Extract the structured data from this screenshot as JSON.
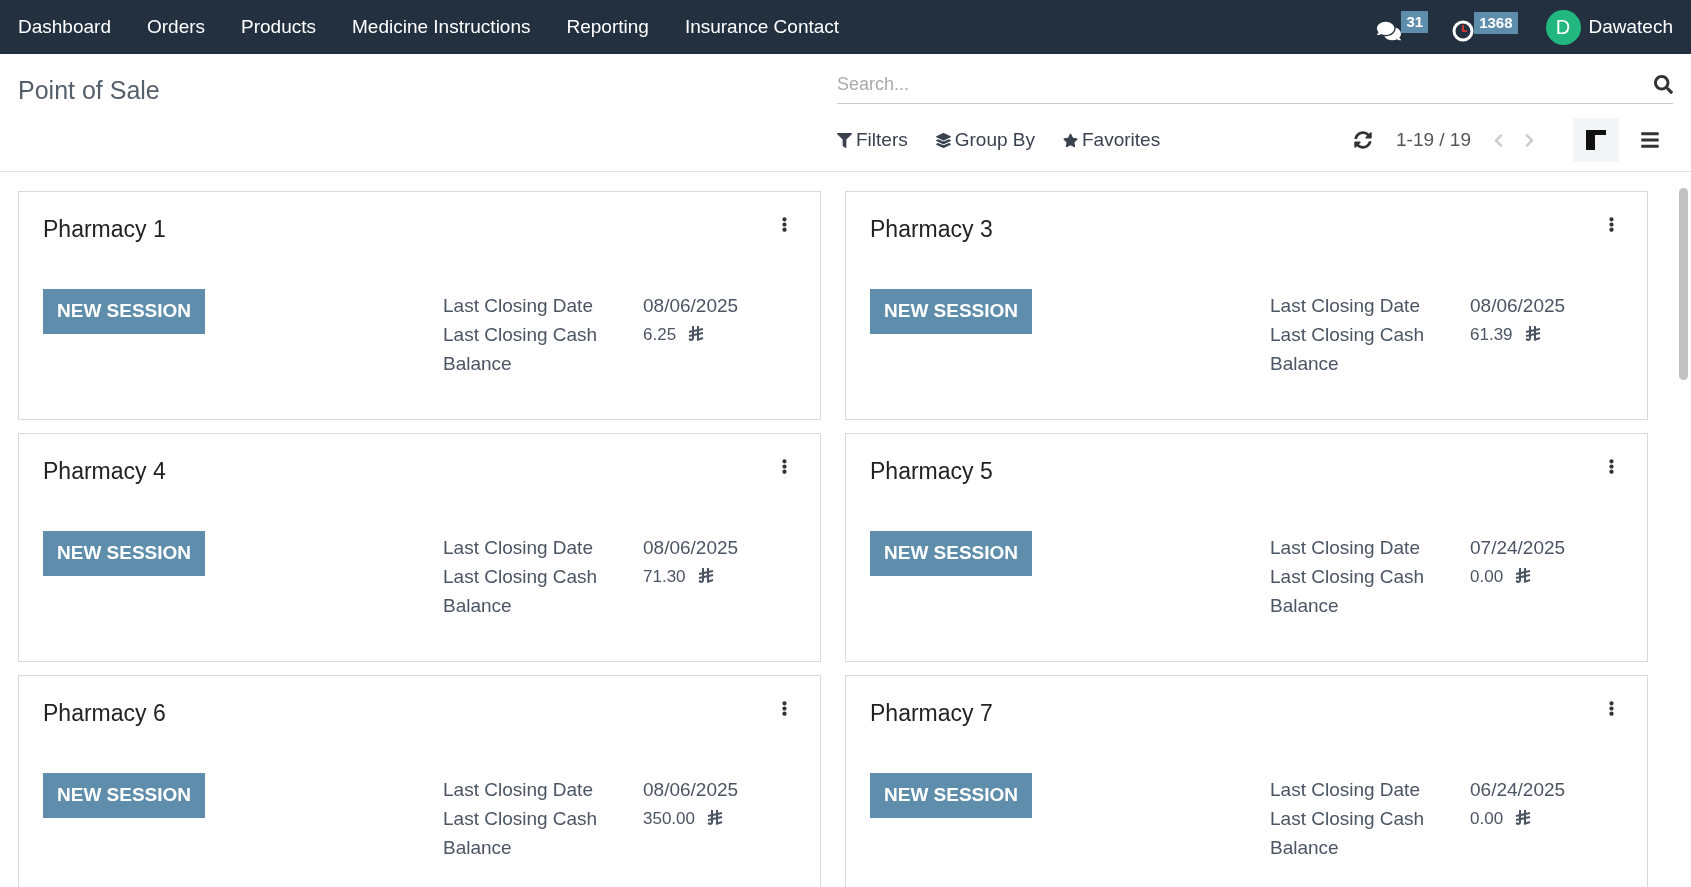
{
  "navbar": {
    "menu": [
      "Dashboard",
      "Orders",
      "Products",
      "Medicine Instructions",
      "Reporting",
      "Insurance Contact"
    ],
    "messages_count": "31",
    "activities_count": "1368",
    "user": {
      "initial": "D",
      "name": "Dawatech"
    }
  },
  "control_panel": {
    "title": "Point of Sale",
    "search": {
      "placeholder": "Search..."
    },
    "filters": [
      {
        "kind": "filter",
        "label": "Filters"
      },
      {
        "kind": "group",
        "label": "Group By"
      },
      {
        "kind": "favorite",
        "label": "Favorites"
      }
    ],
    "pager": "1-19 / 19",
    "views": [
      {
        "kind": "kanban",
        "selected": true
      },
      {
        "kind": "list",
        "selected": false
      }
    ]
  },
  "cards": [
    {
      "name": "Pharmacy 1",
      "button": "NEW SESSION",
      "date_label": "Last Closing Date",
      "date": "08/06/2025",
      "cash_label": "Last Closing Cash",
      "cash_label_2": "Balance",
      "cash": "6.25"
    },
    {
      "name": "Pharmacy 3",
      "button": "NEW SESSION",
      "date_label": "Last Closing Date",
      "date": "08/06/2025",
      "cash_label": "Last Closing Cash",
      "cash_label_2": "Balance",
      "cash": "61.39"
    },
    {
      "name": "Pharmacy 4",
      "button": "NEW SESSION",
      "date_label": "Last Closing Date",
      "date": "08/06/2025",
      "cash_label": "Last Closing Cash",
      "cash_label_2": "Balance",
      "cash": "71.30"
    },
    {
      "name": "Pharmacy 5",
      "button": "NEW SESSION",
      "date_label": "Last Closing Date",
      "date": "07/24/2025",
      "cash_label": "Last Closing Cash",
      "cash_label_2": "Balance",
      "cash": "0.00"
    },
    {
      "name": "Pharmacy 6",
      "button": "NEW SESSION",
      "date_label": "Last Closing Date",
      "date": "08/06/2025",
      "cash_label": "Last Closing Cash",
      "cash_label_2": "Balance",
      "cash": "350.00"
    },
    {
      "name": "Pharmacy 7",
      "button": "NEW SESSION",
      "date_label": "Last Closing Date",
      "date": "06/24/2025",
      "cash_label": "Last Closing Cash",
      "cash_label_2": "Balance",
      "cash": "0.00"
    }
  ]
}
